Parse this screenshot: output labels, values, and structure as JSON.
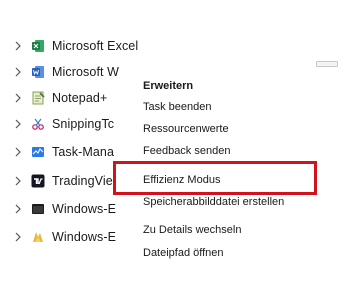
{
  "processes": [
    {
      "name": "Microsoft Excel",
      "icon": "excel-icon"
    },
    {
      "name": "Microsoft W",
      "icon": "word-icon"
    },
    {
      "name": "Notepad+",
      "icon": "notepad-icon"
    },
    {
      "name": "SnippingTc",
      "icon": "snipping-tool-icon"
    },
    {
      "name": "Task-Mana",
      "icon": "task-manager-icon"
    },
    {
      "name": "TradingVie",
      "icon": "tradingview-icon"
    },
    {
      "name": "Windows-E",
      "icon": "windows-explorer-icon"
    },
    {
      "name": "Windows-E",
      "icon": "windows-explorer-folder-icon"
    }
  ],
  "context_menu": {
    "items": [
      {
        "label": "Erweitern",
        "bold": true
      },
      {
        "label": "Task beenden"
      },
      {
        "label": "Ressourcenwerte"
      },
      {
        "label": "Feedback senden"
      },
      {
        "label": "Effizienz Modus"
      },
      {
        "label": "Speicherabbilddatei erstellen"
      },
      {
        "label": "Zu Details wechseln"
      },
      {
        "label": "Dateipfad öffnen"
      }
    ]
  },
  "colors": {
    "highlight": "#d1131d",
    "excel": "#1f7a44",
    "word": "#2b5fbf"
  }
}
